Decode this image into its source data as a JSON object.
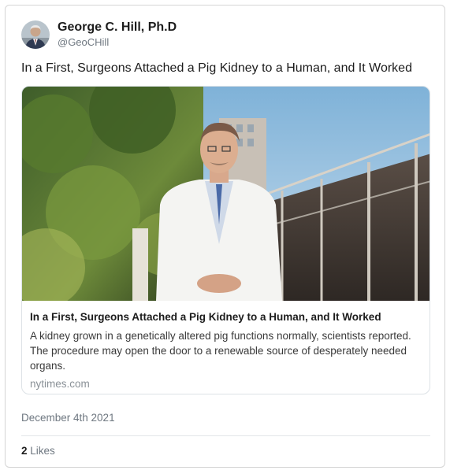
{
  "author": {
    "name": "George C. Hill, Ph.D",
    "handle": "@GeoCHill",
    "avatar_icon": "profile-photo-icon"
  },
  "tweet": {
    "text": "In a First, Surgeons Attached a Pig Kidney to a Human, and It Worked",
    "date": "December 4th 2021"
  },
  "link_card": {
    "image_icon": "surgeon-portrait-photo",
    "title": "In a First, Surgeons Attached a Pig Kidney to a Human, and It Worked",
    "description": "A kidney grown in a genetically altered pig functions normally, scientists reported. The procedure may open the door to a renewable source of desperately needed organs.",
    "domain": "nytimes.com"
  },
  "stats": {
    "likes_count": "2",
    "likes_label": "Likes"
  },
  "colors": {
    "text_primary": "#1c1c1c",
    "text_secondary": "#6e7780",
    "border": "#d5d5d5"
  }
}
